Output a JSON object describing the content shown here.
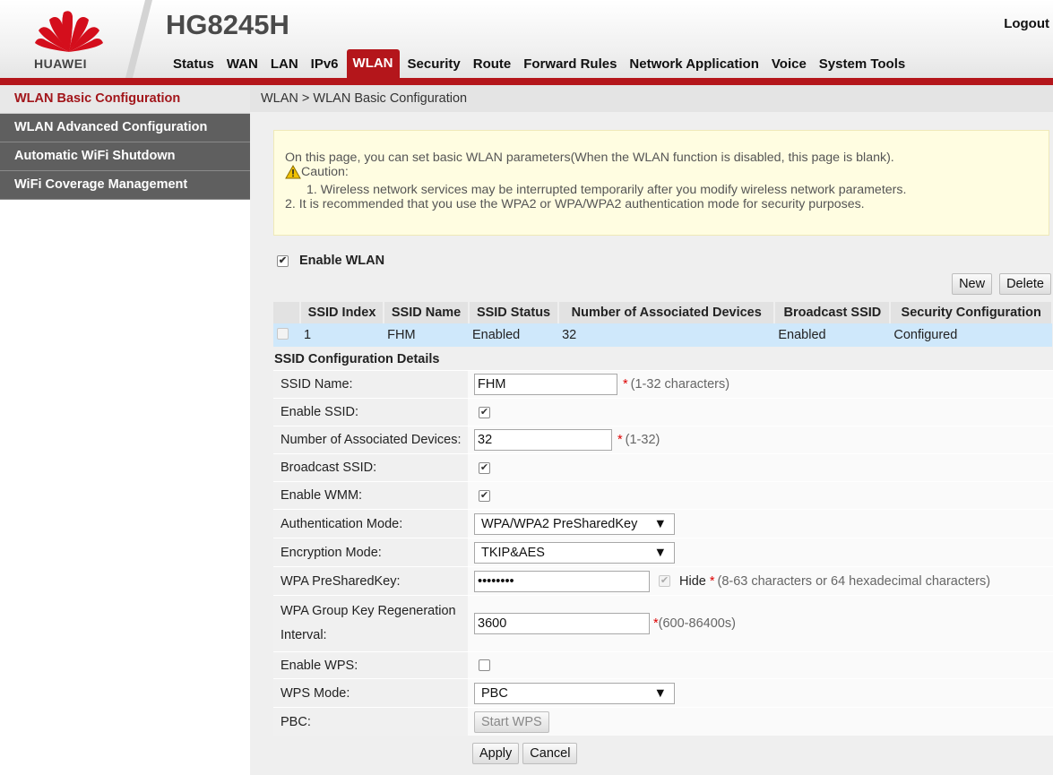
{
  "header": {
    "brand": "HUAWEI",
    "product": "HG8245H",
    "logout": "Logout",
    "nav": [
      "Status",
      "WAN",
      "LAN",
      "IPv6",
      "WLAN",
      "Security",
      "Route",
      "Forward Rules",
      "Network Application",
      "Voice",
      "System Tools"
    ],
    "active_nav": "WLAN",
    "accent_color": "#b4161b"
  },
  "sidebar": {
    "items": [
      {
        "label": "WLAN Basic Configuration"
      },
      {
        "label": "WLAN Advanced Configuration"
      },
      {
        "label": "Automatic WiFi Shutdown"
      },
      {
        "label": "WiFi Coverage Management"
      }
    ]
  },
  "breadcrumb": "WLAN > WLAN Basic Configuration",
  "notice": {
    "line1": "On this page, you can set basic WLAN parameters(When the WLAN function is disabled, this page is blank).",
    "caution": "Caution:",
    "line2": "1. Wireless network services may be interrupted temporarily after you modify wireless network parameters.",
    "line3": "2. It is recommended that you use the WPA2 or WPA/WPA2 authentication mode for security purposes."
  },
  "enable_wlan": {
    "label": "Enable WLAN",
    "checked": true
  },
  "buttons": {
    "new": "New",
    "delete": "Delete",
    "apply": "Apply",
    "cancel": "Cancel",
    "start_wps": "Start WPS"
  },
  "table": {
    "headers": [
      "SSID Index",
      "SSID Name",
      "SSID Status",
      "Number of Associated Devices",
      "Broadcast SSID",
      "Security Configuration"
    ],
    "rows": [
      {
        "index": "1",
        "name": "FHM",
        "status": "Enabled",
        "devices": "32",
        "broadcast": "Enabled",
        "security": "Configured"
      }
    ]
  },
  "details": {
    "title": "SSID Configuration Details",
    "ssid_name": {
      "label": "SSID Name:",
      "value": "FHM",
      "hint": "(1-32 characters)"
    },
    "enable_ssid": {
      "label": "Enable SSID:",
      "checked": true
    },
    "num_devices": {
      "label": "Number of Associated Devices:",
      "value": "32",
      "hint": "(1-32)"
    },
    "broadcast_ssid": {
      "label": "Broadcast SSID:",
      "checked": true
    },
    "enable_wmm": {
      "label": "Enable WMM:",
      "checked": true
    },
    "auth_mode": {
      "label": "Authentication Mode:",
      "value": "WPA/WPA2 PreSharedKey"
    },
    "enc_mode": {
      "label": "Encryption Mode:",
      "value": "TKIP&AES"
    },
    "psk": {
      "label": "WPA PreSharedKey:",
      "value": "••••••••",
      "hide_label": "Hide",
      "hint": "(8-63 characters or 64 hexadecimal characters)"
    },
    "group_key": {
      "label": "WPA Group Key Regeneration Interval:",
      "value": "3600",
      "hint": "(600-86400s)"
    },
    "enable_wps": {
      "label": "Enable WPS:",
      "checked": false
    },
    "wps_mode": {
      "label": "WPS Mode:",
      "value": "PBC"
    },
    "pbc": {
      "label": "PBC:"
    }
  }
}
